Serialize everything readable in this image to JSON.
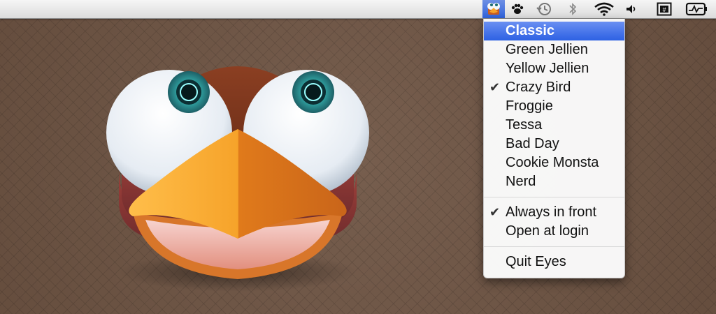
{
  "menubar": {
    "status_items": [
      {
        "name": "eyes-app-icon",
        "active": true
      },
      {
        "name": "paw-icon",
        "active": false
      },
      {
        "name": "time-machine-icon",
        "active": false
      },
      {
        "name": "bluetooth-icon",
        "active": false
      },
      {
        "name": "wifi-icon",
        "active": false
      },
      {
        "name": "volume-icon",
        "active": false
      },
      {
        "name": "input-menu-icon",
        "active": false
      },
      {
        "name": "activity-monitor-icon",
        "active": false
      }
    ]
  },
  "eyes_menu": {
    "themes": [
      {
        "label": "Classic",
        "selected": true,
        "checked": false
      },
      {
        "label": "Green Jellien",
        "selected": false,
        "checked": false
      },
      {
        "label": "Yellow Jellien",
        "selected": false,
        "checked": false
      },
      {
        "label": "Crazy Bird",
        "selected": false,
        "checked": true
      },
      {
        "label": "Froggie",
        "selected": false,
        "checked": false
      },
      {
        "label": "Tessa",
        "selected": false,
        "checked": false
      },
      {
        "label": "Bad Day",
        "selected": false,
        "checked": false
      },
      {
        "label": "Cookie Monsta",
        "selected": false,
        "checked": false
      },
      {
        "label": "Nerd",
        "selected": false,
        "checked": false
      }
    ],
    "options": [
      {
        "label": "Always in front",
        "checked": true
      },
      {
        "label": "Open at login",
        "checked": false
      }
    ],
    "quit_label": "Quit Eyes",
    "check_glyph": "✔"
  },
  "colors": {
    "highlight": "#2d61e3",
    "background": "#6e5443"
  }
}
